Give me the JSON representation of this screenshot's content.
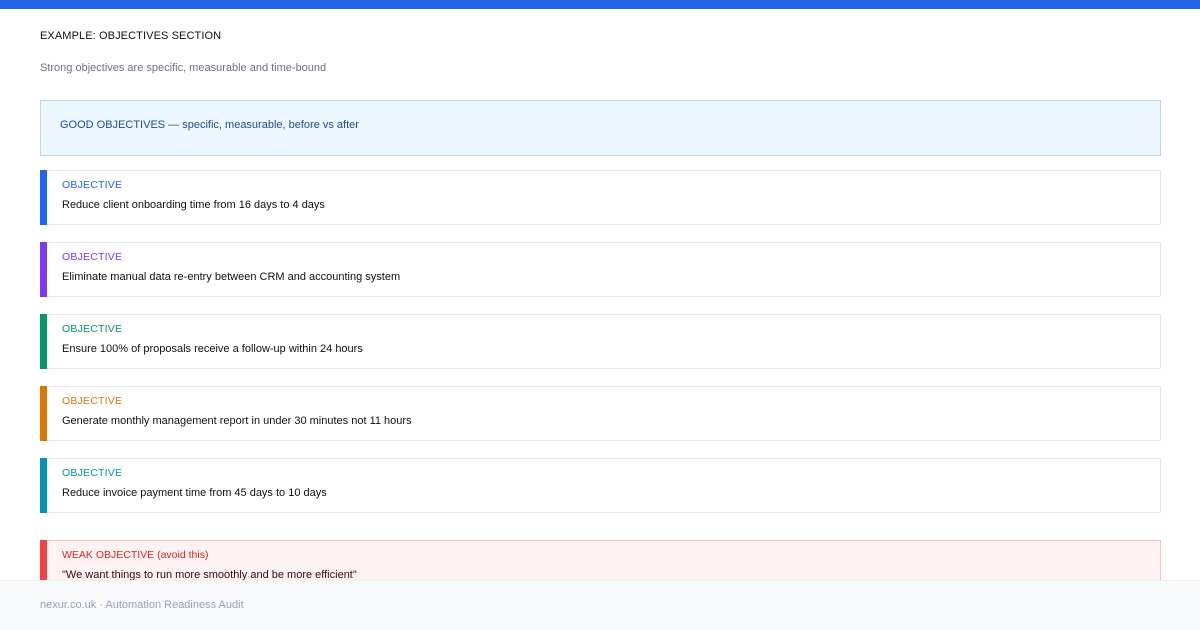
{
  "header": {
    "title": "EXAMPLE: OBJECTIVES SECTION",
    "subtitle": "Strong objectives are specific, measurable and time-bound"
  },
  "good_callout": {
    "text": "GOOD OBJECTIVES — specific, measurable, before vs after"
  },
  "objectives": [
    {
      "label": "OBJECTIVE",
      "text": "Reduce client onboarding time from 16 days to 4 days",
      "color": "#2563eb"
    },
    {
      "label": "OBJECTIVE",
      "text": "Eliminate manual data re-entry between CRM and accounting system",
      "color": "#7c3aed"
    },
    {
      "label": "OBJECTIVE",
      "text": "Ensure 100% of proposals receive a follow-up within 24 hours",
      "color": "#059669"
    },
    {
      "label": "OBJECTIVE",
      "text": "Generate monthly management report in under 30 minutes not 11 hours",
      "color": "#d97706"
    },
    {
      "label": "OBJECTIVE",
      "text": "Reduce invoice payment time from 45 days to 10 days",
      "color": "#0891b2"
    }
  ],
  "weak": {
    "label": "WEAK OBJECTIVE  (avoid this)",
    "text": "\"We want things to run more smoothly and be more efficient\"",
    "color": "#ef4444"
  },
  "footer": {
    "text": "nexur.co.uk · Automation Readiness Audit"
  }
}
